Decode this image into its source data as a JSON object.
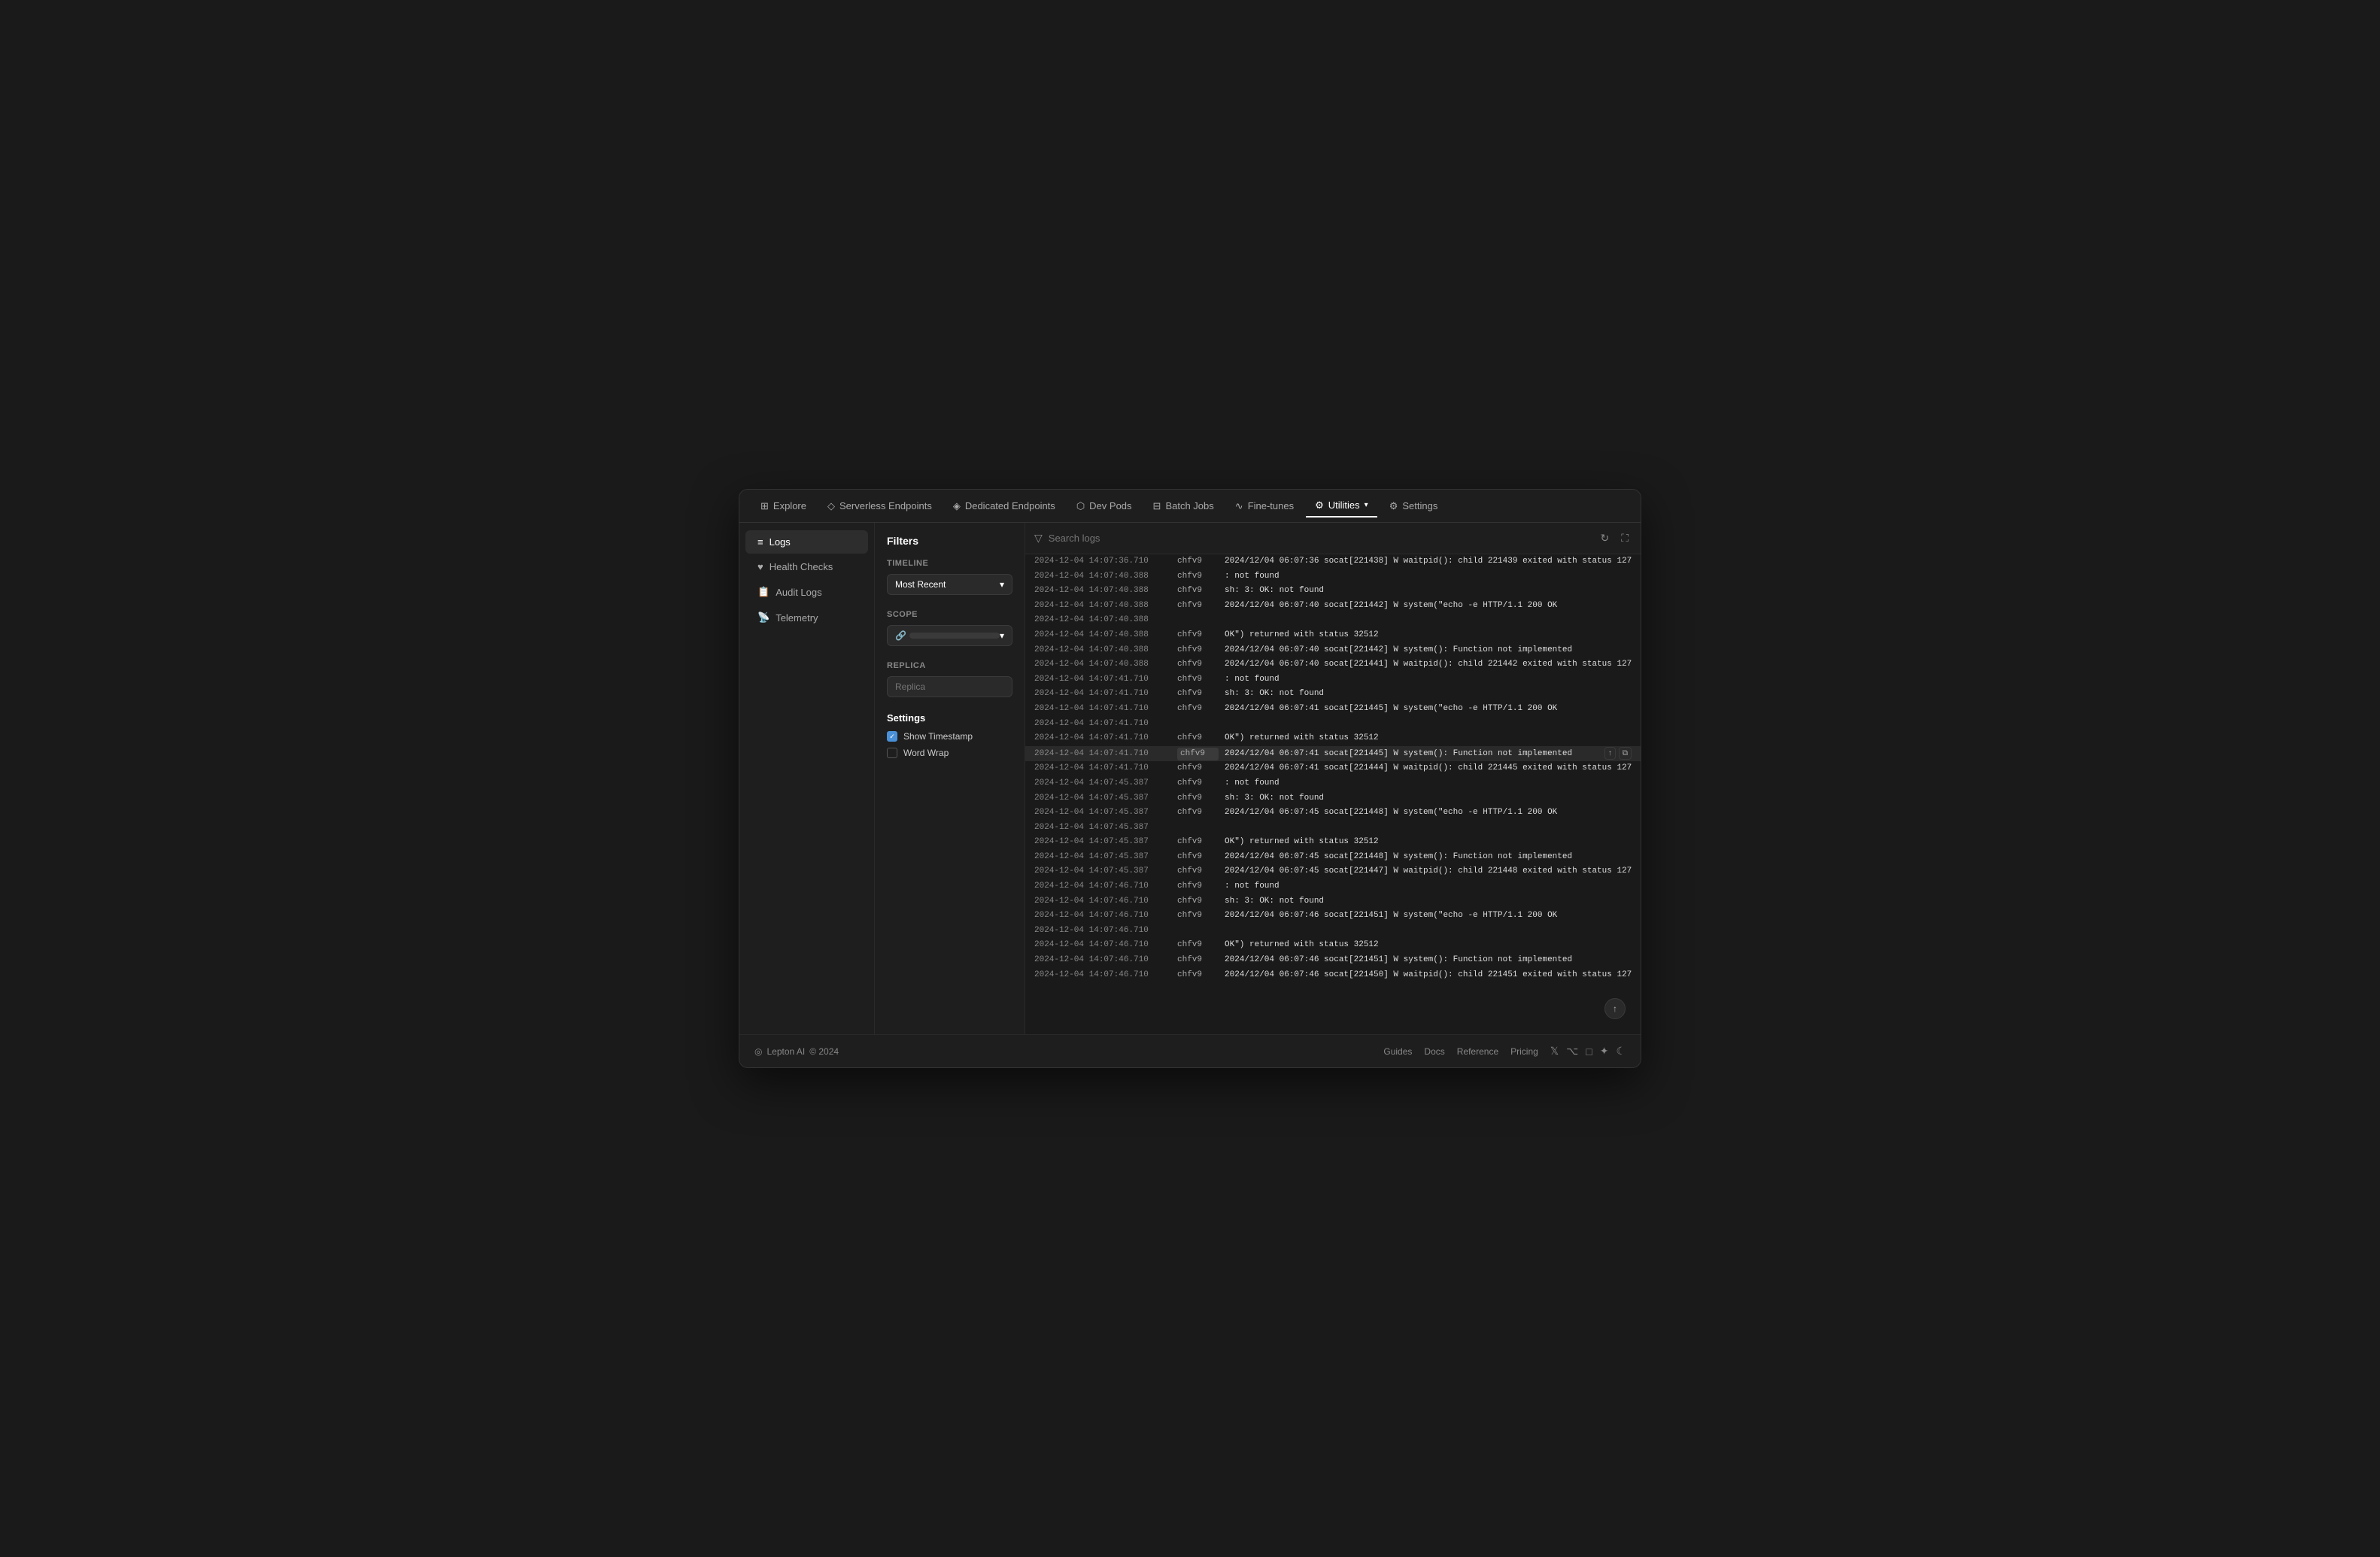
{
  "nav": {
    "items": [
      {
        "id": "explore",
        "label": "Explore",
        "icon": "⊞"
      },
      {
        "id": "serverless",
        "label": "Serverless Endpoints",
        "icon": "◇"
      },
      {
        "id": "dedicated",
        "label": "Dedicated Endpoints",
        "icon": "◈"
      },
      {
        "id": "devpods",
        "label": "Dev Pods",
        "icon": "⬡"
      },
      {
        "id": "batchjobs",
        "label": "Batch Jobs",
        "icon": "⊟"
      },
      {
        "id": "finetunes",
        "label": "Fine-tunes",
        "icon": "∿"
      },
      {
        "id": "utilities",
        "label": "Utilities",
        "icon": "⚙",
        "active": true,
        "hasChevron": true
      },
      {
        "id": "settings",
        "label": "Settings",
        "icon": "⚙"
      }
    ]
  },
  "sidebar": {
    "items": [
      {
        "id": "logs",
        "label": "Logs",
        "icon": "≡",
        "active": true
      },
      {
        "id": "healthchecks",
        "label": "Health Checks",
        "icon": "♥"
      },
      {
        "id": "auditlogs",
        "label": "Audit Logs",
        "icon": "📋"
      },
      {
        "id": "telemetry",
        "label": "Telemetry",
        "icon": "📡"
      }
    ]
  },
  "filters": {
    "title": "Filters",
    "timeline": {
      "label": "Timeline",
      "value": "Most Recent"
    },
    "scope": {
      "label": "Scope",
      "placeholder": "🔗"
    },
    "replica": {
      "label": "Replica",
      "placeholder": "Replica"
    },
    "settings": {
      "title": "Settings",
      "showTimestamp": {
        "label": "Show Timestamp",
        "checked": true
      },
      "wordWrap": {
        "label": "Word Wrap",
        "checked": false
      }
    }
  },
  "logs": {
    "searchPlaceholder": "Search logs",
    "entries": [
      {
        "timestamp": "2024-12-04 14:07:36.710",
        "replica": "chfv9",
        "message": "2024/12/04 06:07:36 socat[221438] W waitpid(): child 221439 exited with status 127"
      },
      {
        "timestamp": "2024-12-04 14:07:40.388",
        "replica": "chfv9",
        "message": ": not found"
      },
      {
        "timestamp": "2024-12-04 14:07:40.388",
        "replica": "chfv9",
        "message": "sh: 3: OK: not found"
      },
      {
        "timestamp": "2024-12-04 14:07:40.388",
        "replica": "chfv9",
        "message": "2024/12/04 06:07:40 socat[221442] W system(\"echo -e HTTP/1.1 200 OK"
      },
      {
        "timestamp": "2024-12-04 14:07:40.388",
        "replica": "",
        "message": ""
      },
      {
        "timestamp": "2024-12-04 14:07:40.388",
        "replica": "chfv9",
        "message": "OK\") returned with status 32512"
      },
      {
        "timestamp": "2024-12-04 14:07:40.388",
        "replica": "chfv9",
        "message": "2024/12/04 06:07:40 socat[221442] W system(): Function not implemented"
      },
      {
        "timestamp": "2024-12-04 14:07:40.388",
        "replica": "chfv9",
        "message": "2024/12/04 06:07:40 socat[221441] W waitpid(): child 221442 exited with status 127"
      },
      {
        "timestamp": "2024-12-04 14:07:41.710",
        "replica": "chfv9",
        "message": ": not found"
      },
      {
        "timestamp": "2024-12-04 14:07:41.710",
        "replica": "chfv9",
        "message": "sh: 3: OK: not found"
      },
      {
        "timestamp": "2024-12-04 14:07:41.710",
        "replica": "chfv9",
        "message": "2024/12/04 06:07:41 socat[221445] W system(\"echo -e HTTP/1.1 200 OK"
      },
      {
        "timestamp": "2024-12-04 14:07:41.710",
        "replica": "",
        "message": ""
      },
      {
        "timestamp": "2024-12-04 14:07:41.710",
        "replica": "chfv9",
        "message": "OK\") returned with status 32512"
      },
      {
        "timestamp": "2024-12-04 14:07:41.710",
        "replica": "chfv9",
        "message": "2024/12/04 06:07:41 socat[221445] W system(): Function not implemented",
        "highlighted": true
      },
      {
        "timestamp": "2024-12-04 14:07:41.710",
        "replica": "chfv9",
        "message": "2024/12/04 06:07:41 socat[221444] W waitpid(): child 221445 exited with status 127"
      },
      {
        "timestamp": "2024-12-04 14:07:45.387",
        "replica": "chfv9",
        "message": ": not found"
      },
      {
        "timestamp": "2024-12-04 14:07:45.387",
        "replica": "chfv9",
        "message": "sh: 3: OK: not found"
      },
      {
        "timestamp": "2024-12-04 14:07:45.387",
        "replica": "chfv9",
        "message": "2024/12/04 06:07:45 socat[221448] W system(\"echo -e HTTP/1.1 200 OK"
      },
      {
        "timestamp": "2024-12-04 14:07:45.387",
        "replica": "",
        "message": ""
      },
      {
        "timestamp": "2024-12-04 14:07:45.387",
        "replica": "chfv9",
        "message": "OK\") returned with status 32512"
      },
      {
        "timestamp": "2024-12-04 14:07:45.387",
        "replica": "chfv9",
        "message": "2024/12/04 06:07:45 socat[221448] W system(): Function not implemented"
      },
      {
        "timestamp": "2024-12-04 14:07:45.387",
        "replica": "chfv9",
        "message": "2024/12/04 06:07:45 socat[221447] W waitpid(): child 221448 exited with status 127"
      },
      {
        "timestamp": "2024-12-04 14:07:46.710",
        "replica": "chfv9",
        "message": ": not found"
      },
      {
        "timestamp": "2024-12-04 14:07:46.710",
        "replica": "chfv9",
        "message": "sh: 3: OK: not found"
      },
      {
        "timestamp": "2024-12-04 14:07:46.710",
        "replica": "chfv9",
        "message": "2024/12/04 06:07:46 socat[221451] W system(\"echo -e HTTP/1.1 200 OK"
      },
      {
        "timestamp": "2024-12-04 14:07:46.710",
        "replica": "",
        "message": ""
      },
      {
        "timestamp": "2024-12-04 14:07:46.710",
        "replica": "chfv9",
        "message": "OK\") returned with status 32512"
      },
      {
        "timestamp": "2024-12-04 14:07:46.710",
        "replica": "chfv9",
        "message": "2024/12/04 06:07:46 socat[221451] W system(): Function not implemented"
      },
      {
        "timestamp": "2024-12-04 14:07:46.710",
        "replica": "chfv9",
        "message": "2024/12/04 06:07:46 socat[221450] W waitpid(): child 221451 exited with status 127"
      }
    ]
  },
  "footer": {
    "brand": "Lepton AI",
    "copyright": "© 2024",
    "links": [
      "Guides",
      "Docs",
      "Reference",
      "Pricing"
    ]
  }
}
